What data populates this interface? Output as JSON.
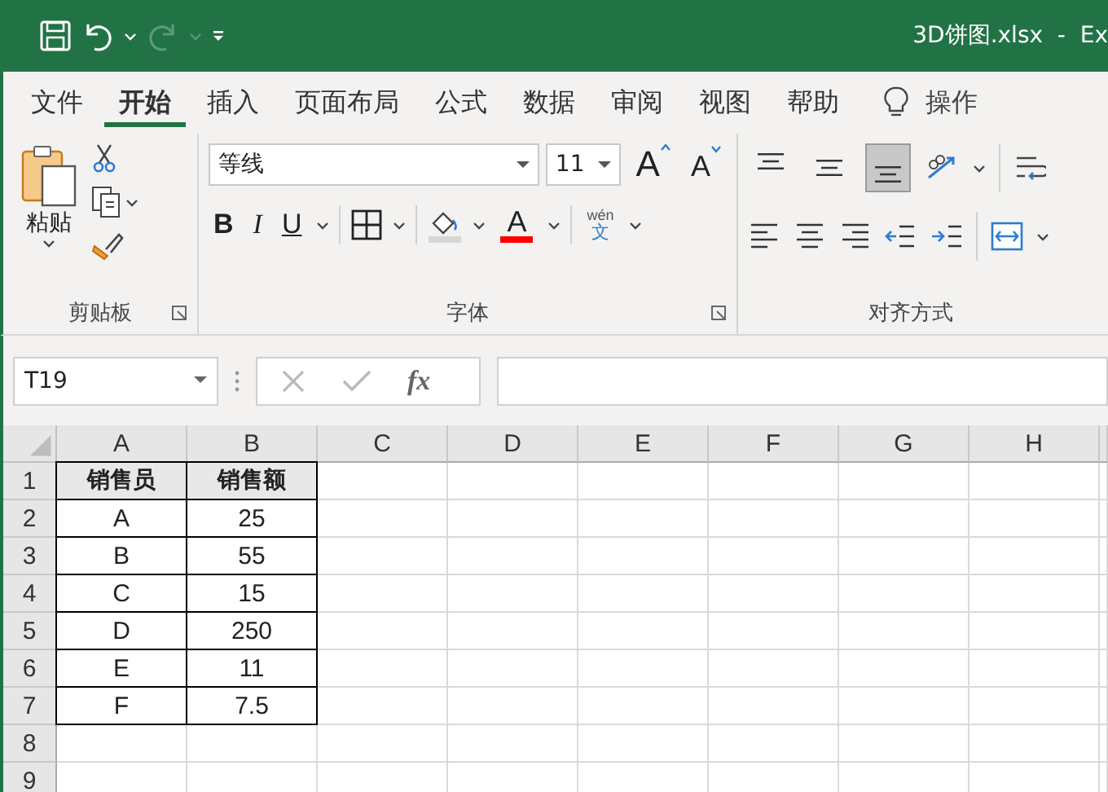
{
  "title_bar": {
    "title": "3D饼图.xlsx  -  Ex",
    "redo_disabled": true
  },
  "tabs": [
    {
      "label": "文件",
      "selected": false
    },
    {
      "label": "开始",
      "selected": true
    },
    {
      "label": "插入",
      "selected": false
    },
    {
      "label": "页面布局",
      "selected": false
    },
    {
      "label": "公式",
      "selected": false
    },
    {
      "label": "数据",
      "selected": false
    },
    {
      "label": "审阅",
      "selected": false
    },
    {
      "label": "视图",
      "selected": false
    },
    {
      "label": "帮助",
      "selected": false
    }
  ],
  "tell_me": "操作",
  "clipboard": {
    "label": "剪贴板",
    "paste": "粘贴"
  },
  "font": {
    "label": "字体",
    "name": "等线",
    "size": "11",
    "grow": "A",
    "shrink": "A",
    "bold": "B",
    "italic": "I",
    "underline": "U",
    "color_letter": "A",
    "color": "#ff0000",
    "phonetic_top": "wén",
    "phonetic_bottom": "文"
  },
  "alignment": {
    "label": "对齐方式",
    "vertical": [
      {
        "selected": false
      },
      {
        "selected": false
      },
      {
        "selected": true
      }
    ]
  },
  "name_box": "T19",
  "fx": "fx",
  "sheet": {
    "columns": [
      "A",
      "B",
      "C",
      "D",
      "E",
      "F",
      "G",
      "H"
    ],
    "rows": [
      {
        "number": "1",
        "kind": "header",
        "cells": [
          "销售员",
          "销售额"
        ]
      },
      {
        "number": "2",
        "kind": "data",
        "cells": [
          "A",
          "25"
        ]
      },
      {
        "number": "3",
        "kind": "data",
        "cells": [
          "B",
          "55"
        ]
      },
      {
        "number": "4",
        "kind": "data",
        "cells": [
          "C",
          "15"
        ]
      },
      {
        "number": "5",
        "kind": "data",
        "cells": [
          "D",
          "250"
        ]
      },
      {
        "number": "6",
        "kind": "data",
        "cells": [
          "E",
          "11"
        ]
      },
      {
        "number": "7",
        "kind": "data",
        "cells": [
          "F",
          "7.5"
        ]
      },
      {
        "number": "8",
        "cells": []
      },
      {
        "number": "9",
        "cells": []
      }
    ]
  }
}
